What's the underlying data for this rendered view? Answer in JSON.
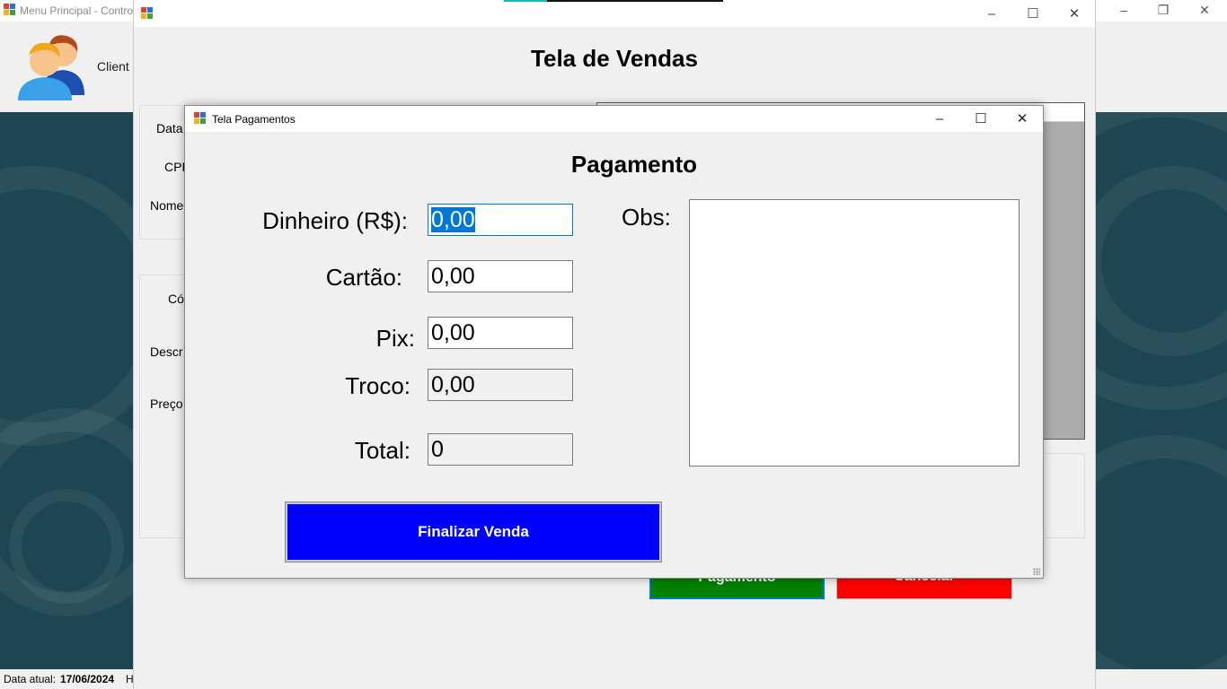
{
  "main_window": {
    "title": "Menu Principal - Contro",
    "toolbar_label": "Client",
    "status": {
      "date_label": "Data atual:",
      "date_value": "17/06/2024",
      "extra": "H"
    },
    "icons": {
      "users": "users-icon"
    }
  },
  "vendas_window": {
    "heading": "Tela de Vendas",
    "labels": [
      "Data",
      "CPF",
      "Nome",
      "Có",
      "Descr",
      "Preço"
    ],
    "pagamento_button": "Pagamento",
    "cancelar_button": "Cancelar"
  },
  "pagamentos_dialog": {
    "title": "Tela Pagamentos",
    "heading": "Pagamento",
    "fields": {
      "dinheiro_label": "Dinheiro (R$):",
      "dinheiro_value": "0,00",
      "cartao_label": "Cartão:",
      "cartao_value": "0,00",
      "pix_label": "Pix:",
      "pix_value": "0,00",
      "troco_label": "Troco:",
      "troco_value": "0,00",
      "total_label": "Total:",
      "total_value": "0"
    },
    "obs_label": "Obs:",
    "obs_value": "",
    "finalizar_button": "Finalizar Venda"
  },
  "colors": {
    "finalizar": "#0000ff",
    "pagamento": "#008000",
    "cancelar": "#ff0000",
    "selection": "#0078d7",
    "desktop": "#1e4652"
  }
}
